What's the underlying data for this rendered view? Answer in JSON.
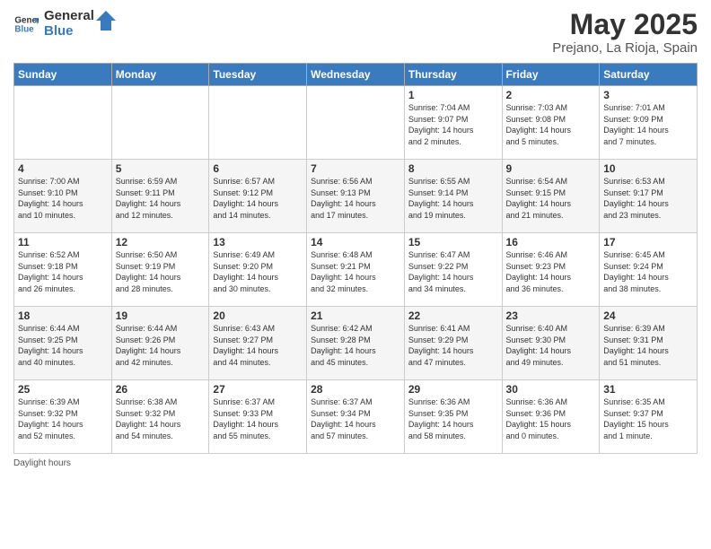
{
  "logo": {
    "line1": "General",
    "line2": "Blue"
  },
  "title": "May 2025",
  "subtitle": "Prejano, La Rioja, Spain",
  "days_of_week": [
    "Sunday",
    "Monday",
    "Tuesday",
    "Wednesday",
    "Thursday",
    "Friday",
    "Saturday"
  ],
  "weeks": [
    [
      {
        "day": "",
        "info": ""
      },
      {
        "day": "",
        "info": ""
      },
      {
        "day": "",
        "info": ""
      },
      {
        "day": "",
        "info": ""
      },
      {
        "day": "1",
        "info": "Sunrise: 7:04 AM\nSunset: 9:07 PM\nDaylight: 14 hours\nand 2 minutes."
      },
      {
        "day": "2",
        "info": "Sunrise: 7:03 AM\nSunset: 9:08 PM\nDaylight: 14 hours\nand 5 minutes."
      },
      {
        "day": "3",
        "info": "Sunrise: 7:01 AM\nSunset: 9:09 PM\nDaylight: 14 hours\nand 7 minutes."
      }
    ],
    [
      {
        "day": "4",
        "info": "Sunrise: 7:00 AM\nSunset: 9:10 PM\nDaylight: 14 hours\nand 10 minutes."
      },
      {
        "day": "5",
        "info": "Sunrise: 6:59 AM\nSunset: 9:11 PM\nDaylight: 14 hours\nand 12 minutes."
      },
      {
        "day": "6",
        "info": "Sunrise: 6:57 AM\nSunset: 9:12 PM\nDaylight: 14 hours\nand 14 minutes."
      },
      {
        "day": "7",
        "info": "Sunrise: 6:56 AM\nSunset: 9:13 PM\nDaylight: 14 hours\nand 17 minutes."
      },
      {
        "day": "8",
        "info": "Sunrise: 6:55 AM\nSunset: 9:14 PM\nDaylight: 14 hours\nand 19 minutes."
      },
      {
        "day": "9",
        "info": "Sunrise: 6:54 AM\nSunset: 9:15 PM\nDaylight: 14 hours\nand 21 minutes."
      },
      {
        "day": "10",
        "info": "Sunrise: 6:53 AM\nSunset: 9:17 PM\nDaylight: 14 hours\nand 23 minutes."
      }
    ],
    [
      {
        "day": "11",
        "info": "Sunrise: 6:52 AM\nSunset: 9:18 PM\nDaylight: 14 hours\nand 26 minutes."
      },
      {
        "day": "12",
        "info": "Sunrise: 6:50 AM\nSunset: 9:19 PM\nDaylight: 14 hours\nand 28 minutes."
      },
      {
        "day": "13",
        "info": "Sunrise: 6:49 AM\nSunset: 9:20 PM\nDaylight: 14 hours\nand 30 minutes."
      },
      {
        "day": "14",
        "info": "Sunrise: 6:48 AM\nSunset: 9:21 PM\nDaylight: 14 hours\nand 32 minutes."
      },
      {
        "day": "15",
        "info": "Sunrise: 6:47 AM\nSunset: 9:22 PM\nDaylight: 14 hours\nand 34 minutes."
      },
      {
        "day": "16",
        "info": "Sunrise: 6:46 AM\nSunset: 9:23 PM\nDaylight: 14 hours\nand 36 minutes."
      },
      {
        "day": "17",
        "info": "Sunrise: 6:45 AM\nSunset: 9:24 PM\nDaylight: 14 hours\nand 38 minutes."
      }
    ],
    [
      {
        "day": "18",
        "info": "Sunrise: 6:44 AM\nSunset: 9:25 PM\nDaylight: 14 hours\nand 40 minutes."
      },
      {
        "day": "19",
        "info": "Sunrise: 6:44 AM\nSunset: 9:26 PM\nDaylight: 14 hours\nand 42 minutes."
      },
      {
        "day": "20",
        "info": "Sunrise: 6:43 AM\nSunset: 9:27 PM\nDaylight: 14 hours\nand 44 minutes."
      },
      {
        "day": "21",
        "info": "Sunrise: 6:42 AM\nSunset: 9:28 PM\nDaylight: 14 hours\nand 45 minutes."
      },
      {
        "day": "22",
        "info": "Sunrise: 6:41 AM\nSunset: 9:29 PM\nDaylight: 14 hours\nand 47 minutes."
      },
      {
        "day": "23",
        "info": "Sunrise: 6:40 AM\nSunset: 9:30 PM\nDaylight: 14 hours\nand 49 minutes."
      },
      {
        "day": "24",
        "info": "Sunrise: 6:39 AM\nSunset: 9:31 PM\nDaylight: 14 hours\nand 51 minutes."
      }
    ],
    [
      {
        "day": "25",
        "info": "Sunrise: 6:39 AM\nSunset: 9:32 PM\nDaylight: 14 hours\nand 52 minutes."
      },
      {
        "day": "26",
        "info": "Sunrise: 6:38 AM\nSunset: 9:32 PM\nDaylight: 14 hours\nand 54 minutes."
      },
      {
        "day": "27",
        "info": "Sunrise: 6:37 AM\nSunset: 9:33 PM\nDaylight: 14 hours\nand 55 minutes."
      },
      {
        "day": "28",
        "info": "Sunrise: 6:37 AM\nSunset: 9:34 PM\nDaylight: 14 hours\nand 57 minutes."
      },
      {
        "day": "29",
        "info": "Sunrise: 6:36 AM\nSunset: 9:35 PM\nDaylight: 14 hours\nand 58 minutes."
      },
      {
        "day": "30",
        "info": "Sunrise: 6:36 AM\nSunset: 9:36 PM\nDaylight: 15 hours\nand 0 minutes."
      },
      {
        "day": "31",
        "info": "Sunrise: 6:35 AM\nSunset: 9:37 PM\nDaylight: 15 hours\nand 1 minute."
      }
    ]
  ],
  "footer": {
    "daylight_label": "Daylight hours"
  }
}
